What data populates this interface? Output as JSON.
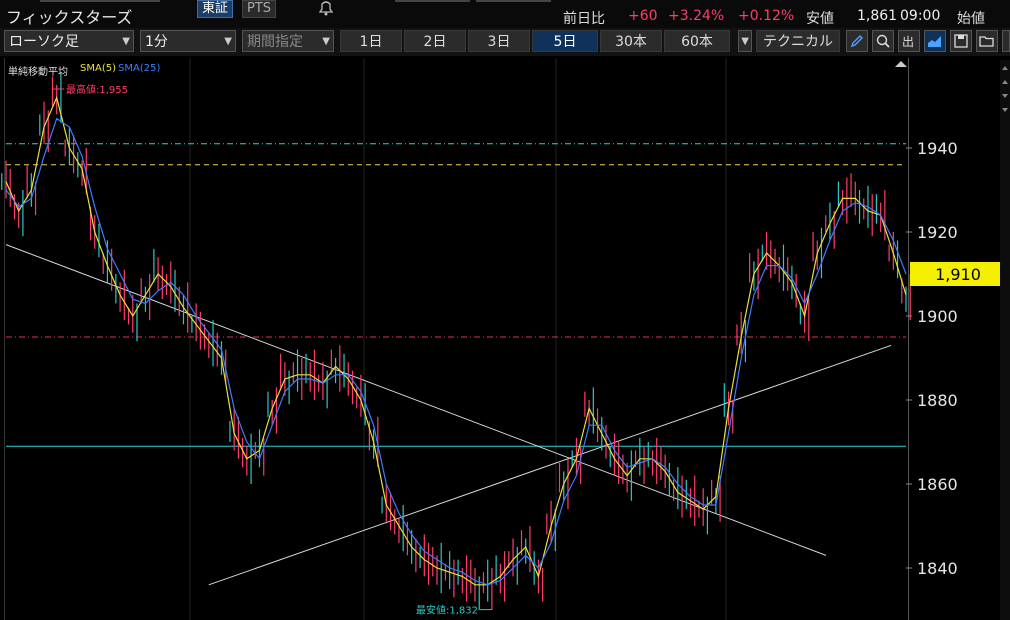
{
  "header": {
    "stock_name": "フィックスターズ",
    "exchange_tabs": [
      "東証",
      "PTS"
    ],
    "quote": {
      "change_label": "前日比",
      "change": "+60",
      "change_pct": "+3.24%",
      "sub_pct": "+0.12%",
      "low_label": "安値",
      "low_value": "1,861",
      "time": "09:00",
      "open_label": "始値"
    }
  },
  "toolbar": {
    "chart_type": "ローソク足",
    "interval": "1分",
    "period": "期間指定",
    "range_tabs": [
      "1日",
      "2日",
      "3日",
      "5日",
      "30本",
      "60本"
    ],
    "active_range": "5日",
    "technical": "テクニカル"
  },
  "indicators": {
    "title": "単純移動平均",
    "sma5": "SMA(5)",
    "sma25": "SMA(25)"
  },
  "annotations": {
    "high_label": "最高値:1,955",
    "low_label": "最安値:1,832"
  },
  "price_tag": "1,910",
  "colors": {
    "up": "#ff3d6a",
    "sma5": "#e7e23a",
    "sma25": "#3b7dff",
    "price_tag_bg": "#f5f000",
    "hline_cyan": "#29d6d6",
    "hline_yellow": "#e8d14a",
    "hline_red": "#e4304f"
  },
  "chart_data": {
    "type": "line",
    "ylim": [
      1830,
      1960
    ],
    "yticks": [
      1840,
      1860,
      1880,
      1900,
      1920,
      1940
    ],
    "horizontal_lines": [
      {
        "value": 1941,
        "style": "dash-dot",
        "color": "cyan"
      },
      {
        "value": 1936,
        "style": "dashed",
        "color": "yellow"
      },
      {
        "value": 1895,
        "style": "dash-dot",
        "color": "red"
      },
      {
        "value": 1869,
        "style": "solid",
        "color": "cyan"
      }
    ],
    "last_price": 1910,
    "high": 1955,
    "low": 1832,
    "series": [
      {
        "name": "SMA(5)",
        "values": [
          1932,
          1925,
          1930,
          1945,
          1952,
          1940,
          1935,
          1920,
          1912,
          1905,
          1900,
          1905,
          1910,
          1907,
          1902,
          1898,
          1894,
          1890,
          1872,
          1866,
          1868,
          1878,
          1885,
          1886,
          1886,
          1884,
          1888,
          1885,
          1880,
          1870,
          1855,
          1850,
          1845,
          1842,
          1840,
          1839,
          1838,
          1836,
          1836,
          1838,
          1842,
          1845,
          1838,
          1850,
          1860,
          1866,
          1878,
          1872,
          1866,
          1862,
          1866,
          1866,
          1863,
          1858,
          1856,
          1854,
          1857,
          1878,
          1895,
          1910,
          1915,
          1912,
          1908,
          1900,
          1915,
          1922,
          1928,
          1928,
          1925,
          1924,
          1915,
          1905
        ]
      },
      {
        "name": "SMA(25)",
        "values": [
          1930,
          1926,
          1928,
          1938,
          1947,
          1945,
          1938,
          1926,
          1916,
          1910,
          1904,
          1903,
          1906,
          1908,
          1905,
          1900,
          1896,
          1892,
          1878,
          1870,
          1866,
          1874,
          1882,
          1885,
          1885,
          1884,
          1886,
          1886,
          1882,
          1874,
          1860,
          1853,
          1848,
          1844,
          1842,
          1840,
          1839,
          1837,
          1836,
          1837,
          1840,
          1843,
          1840,
          1846,
          1856,
          1862,
          1874,
          1874,
          1868,
          1864,
          1865,
          1866,
          1864,
          1860,
          1857,
          1855,
          1855,
          1872,
          1890,
          1905,
          1912,
          1912,
          1909,
          1903,
          1910,
          1918,
          1925,
          1927,
          1926,
          1924,
          1918,
          1910
        ]
      }
    ],
    "trendlines": [
      {
        "from": [
          0,
          1917
        ],
        "to": [
          71,
          1843
        ]
      },
      {
        "from": [
          16,
          1836
        ],
        "to": [
          71,
          1893
        ]
      }
    ]
  }
}
